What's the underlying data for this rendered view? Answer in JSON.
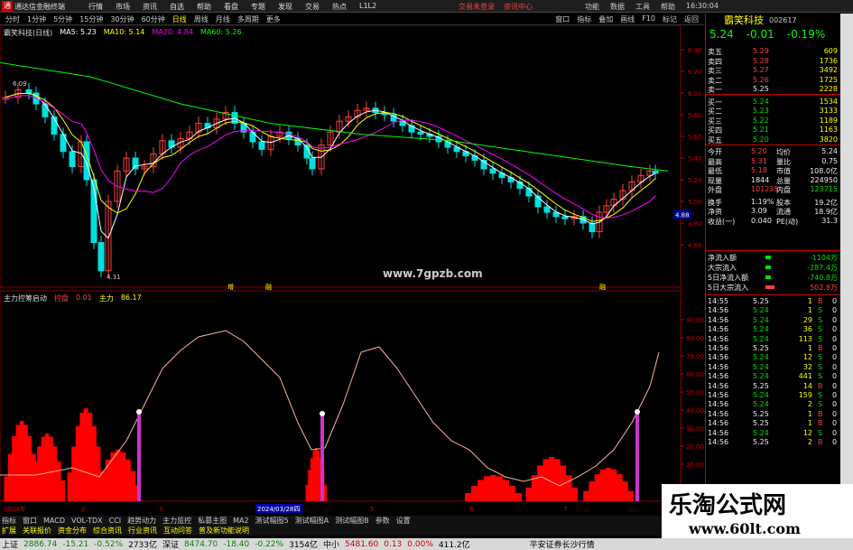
{
  "topbar": {
    "app_title": "通达信金融终端",
    "menu": [
      "行情",
      "市场",
      "资讯",
      "自选",
      "帮助",
      "看盘",
      "专题",
      "发现",
      "交易",
      "热点",
      "L1L2"
    ],
    "trade_links": [
      "交易未登录",
      "资讯中心"
    ],
    "right_items": [
      "功能",
      "数据",
      "工具",
      "帮助",
      "16:30:04"
    ]
  },
  "periodbar": {
    "items": [
      "分时",
      "1分钟",
      "5分钟",
      "15分钟",
      "30分钟",
      "60分钟",
      "日线",
      "周线",
      "月线",
      "多周期",
      "更多"
    ],
    "active": "日线",
    "right_items": [
      "窗口",
      "指标",
      "叠加",
      "画线",
      "F10",
      "标记",
      "返回"
    ]
  },
  "main_info": {
    "name": "霸笑科技(日线)",
    "ma5": "MA5: 5.23",
    "ma10": "MA10: 5.14",
    "ma20": "MA20: 4.84",
    "ma60": "MA60: 5.26"
  },
  "price_axis": [
    "6.40",
    "6.20",
    "6.00",
    "5.80",
    "5.60",
    "5.40",
    "5.20",
    "5.00",
    "4.80",
    "4.60"
  ],
  "chart_labels": {
    "high": "6.09",
    "low": "4.31",
    "current_tag": "4.88",
    "markers": [
      "增",
      "融",
      "融"
    ]
  },
  "url_text": "www.7gpzb.com",
  "indicator_info": {
    "name": "主力控筹启动",
    "label1": "控盘",
    "val1": "0.01",
    "label2": "主力",
    "val2": "86.17"
  },
  "indicator_axis": [
    "90.00",
    "80.00",
    "70.00",
    "60.00",
    "50.00",
    "40.00",
    "30.00",
    "20.00",
    "10.00"
  ],
  "date_axis": [
    "2024年",
    "2",
    "3",
    "2024/03/28四",
    "5",
    "6",
    "7"
  ],
  "stock": {
    "name": "霸笑科技",
    "code": "002617",
    "price": "5.24",
    "change": "-0.01",
    "pct": "-0.19%"
  },
  "orderbook": [
    {
      "label": "卖五",
      "price": "5.29",
      "vol": "609"
    },
    {
      "label": "卖四",
      "price": "5.28",
      "vol": "1736"
    },
    {
      "label": "卖三",
      "price": "5.27",
      "vol": "3492"
    },
    {
      "label": "卖二",
      "price": "5.26",
      "vol": "1725"
    },
    {
      "label": "卖一",
      "price": "5.25",
      "vol": "2228"
    },
    {
      "label": "买一",
      "price": "5.24",
      "vol": "1534"
    },
    {
      "label": "买二",
      "price": "5.23",
      "vol": "3133"
    },
    {
      "label": "买三",
      "price": "5.22",
      "vol": "1189"
    },
    {
      "label": "买四",
      "price": "5.21",
      "vol": "1163"
    },
    {
      "label": "买五",
      "price": "5.20",
      "vol": "3820"
    }
  ],
  "stats": [
    {
      "l1": "今开",
      "v1": "5.20",
      "l2": "均价",
      "v2": "5.24"
    },
    {
      "l1": "最高",
      "v1": "5.31",
      "l2": "量比",
      "v2": "0.75"
    },
    {
      "l1": "最低",
      "v1": "5.18",
      "l2": "市值",
      "v2": "108.0亿"
    },
    {
      "l1": "现量",
      "v1": "1844",
      "l2": "总量",
      "v2": "224950"
    },
    {
      "l1": "外盘",
      "v1": "101235",
      "l2": "内盘",
      "v2": "123715"
    },
    {
      "l1": "换手",
      "v1": "1.19%",
      "l2": "股本",
      "v2": "19.2亿"
    },
    {
      "l1": "净资",
      "v1": "3.09",
      "l2": "流通",
      "v2": "18.9亿"
    },
    {
      "l1": "收益(一)",
      "v1": "0.040",
      "l2": "PE(动)",
      "v2": "31.3"
    }
  ],
  "flows": [
    {
      "label": "净流入额",
      "val": "-1104万"
    },
    {
      "label": "大宗流入",
      "val": "-287.4万"
    },
    {
      "label": "5日净流入额",
      "val": "-740.8万"
    },
    {
      "label": "5日大宗流入",
      "val": "502.8万"
    }
  ],
  "ticks": [
    {
      "t": "14:55",
      "p": "5.25",
      "v": "1",
      "s": "B"
    },
    {
      "t": "14:56",
      "p": "5.24",
      "v": "1",
      "s": "S"
    },
    {
      "t": "14:56",
      "p": "5.24",
      "v": "29",
      "s": "S"
    },
    {
      "t": "14:56",
      "p": "5.24",
      "v": "36",
      "s": "S"
    },
    {
      "t": "14:56",
      "p": "5.24",
      "v": "113",
      "s": "S"
    },
    {
      "t": "14:56",
      "p": "5.25",
      "v": "1",
      "s": "B"
    },
    {
      "t": "14:56",
      "p": "5.24",
      "v": "12",
      "s": "S"
    },
    {
      "t": "14:56",
      "p": "5.24",
      "v": "32",
      "s": "S"
    },
    {
      "t": "14:56",
      "p": "5.24",
      "v": "441",
      "s": "S"
    },
    {
      "t": "14:56",
      "p": "5.25",
      "v": "14",
      "s": "B"
    },
    {
      "t": "14:56",
      "p": "5.24",
      "v": "159",
      "s": "S"
    },
    {
      "t": "14:56",
      "p": "5.24",
      "v": "2",
      "s": "S"
    },
    {
      "t": "14:56",
      "p": "5.25",
      "v": "1",
      "s": "B"
    },
    {
      "t": "14:56",
      "p": "5.25",
      "v": "1",
      "s": "B"
    },
    {
      "t": "14:56",
      "p": "5.24",
      "v": "12",
      "s": "S"
    },
    {
      "t": "14:56",
      "p": "5.25",
      "v": "2",
      "s": "B"
    }
  ],
  "tabs": [
    "指标",
    "窗口",
    "MACD",
    "VOL-TDX",
    "CCI",
    "趋势动力",
    "主力监控",
    "私募主图",
    "MA2",
    "测试幅图5",
    "测试幅图A",
    "测试幅图B",
    "参数",
    "设置"
  ],
  "tabs2": [
    "扩展",
    "关联报价",
    "资金分布",
    "综合资讯",
    "行业资讯",
    "互动问答",
    "普及新功能说明"
  ],
  "statusbar": {
    "sh_label": "上证",
    "sh_val": "2886.74",
    "sh_chg": "-15.21",
    "sh_pct": "-0.52%",
    "sh_amt": "2733亿",
    "sz_label": "深证",
    "sz_val": "8474.70",
    "sz_chg": "-18.40",
    "sz_pct": "-0.22%",
    "sz_amt": "3154亿",
    "zx_label": "中小",
    "zx_val": "5481.60",
    "zx_chg": "0.13",
    "zx_pct": "0.00%",
    "zx_amt": "411.2亿",
    "broker": "平安证券长沙行情"
  },
  "watermark": {
    "line1": "乐淘公式网",
    "line2": "www.60lt.com"
  },
  "colors": {
    "up": "#ff4040",
    "down": "#00e0e0",
    "ma5": "#ffffff",
    "ma10": "#ffff00",
    "ma20": "#ff00ff",
    "ma60": "#00ff00",
    "signal": "#cc33cc",
    "curve": "#ffb0a0"
  }
}
